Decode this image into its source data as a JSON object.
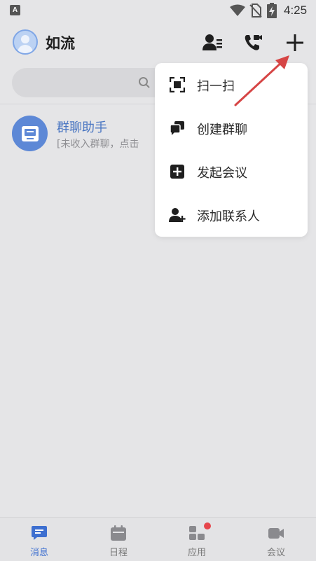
{
  "status_bar": {
    "app_badge": "A",
    "time": "4:25",
    "icons": [
      "wifi-icon",
      "no-sim-icon",
      "battery-charging-icon"
    ]
  },
  "header": {
    "title": "如流",
    "icons": [
      "avatar",
      "contacts-icon",
      "video-call-icon",
      "plus-icon"
    ]
  },
  "search": {
    "icon": "search-icon"
  },
  "conversations": [
    {
      "title": "群聊助手",
      "preview": "[未收入群聊，点击",
      "icon": "inbox-icon"
    }
  ],
  "menu": {
    "items": [
      {
        "label": "扫一扫",
        "icon": "scan-icon"
      },
      {
        "label": "创建群聊",
        "icon": "group-chat-icon"
      },
      {
        "label": "发起会议",
        "icon": "add-meeting-icon"
      },
      {
        "label": "添加联系人",
        "icon": "add-contact-icon"
      }
    ]
  },
  "bottom_nav": {
    "tabs": [
      {
        "label": "消息",
        "icon": "message-icon",
        "active": true
      },
      {
        "label": "日程",
        "icon": "calendar-icon",
        "active": false
      },
      {
        "label": "应用",
        "icon": "apps-icon",
        "active": false,
        "badge_dot": true
      },
      {
        "label": "会议",
        "icon": "video-camera-icon",
        "active": false
      }
    ]
  },
  "colors": {
    "background": "#e5e5e7",
    "accent": "#3d6fd0",
    "conversation_avatar": "#5d88d6",
    "conversation_title": "#4a76c2",
    "annotation_arrow": "#d64545",
    "badge_dot": "#e6454b"
  }
}
